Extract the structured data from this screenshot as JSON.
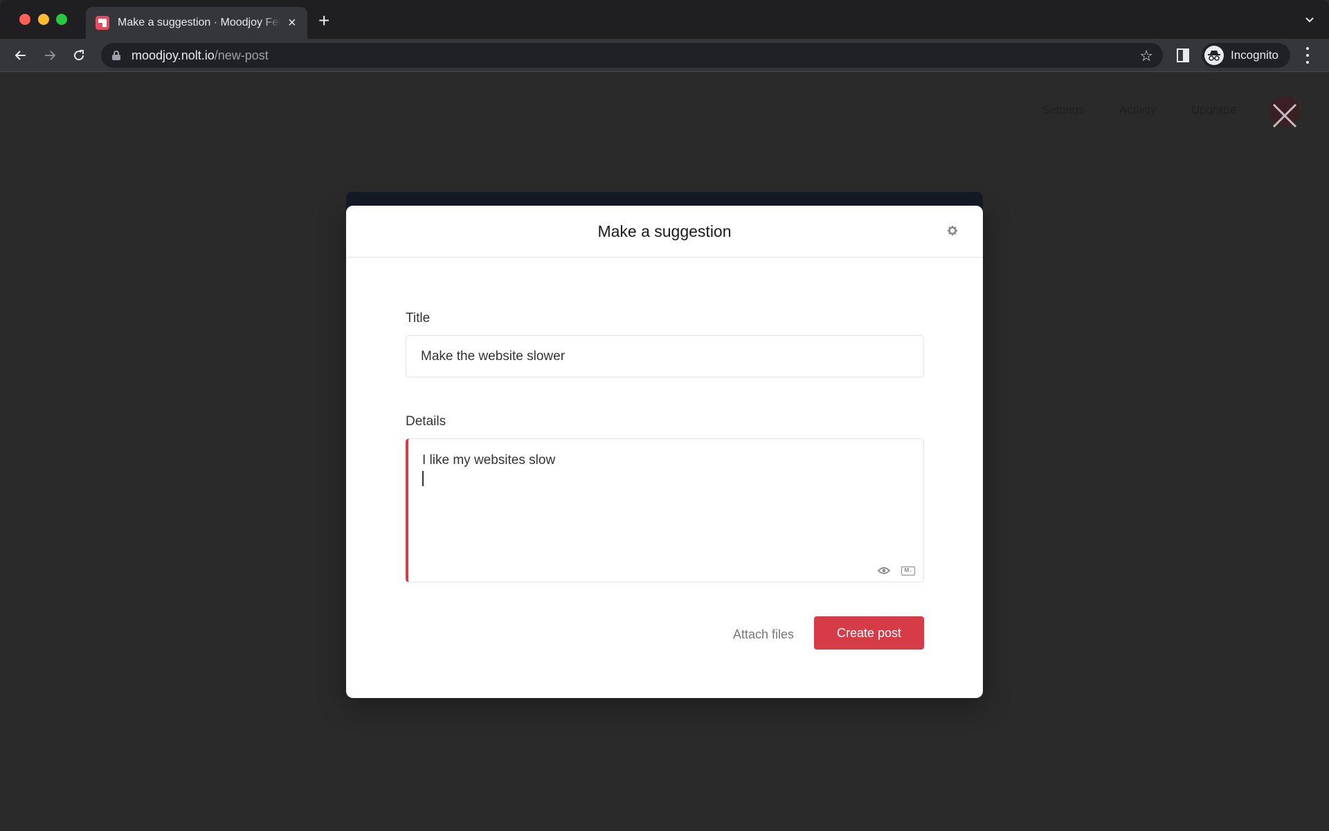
{
  "browser": {
    "tab": {
      "title": "Make a suggestion · Moodjoy Feedback",
      "close_icon": "×"
    },
    "new_tab_icon": "+",
    "url": {
      "host": "moodjoy.nolt.io",
      "path": "/new-post"
    },
    "profile_label": "Incognito"
  },
  "page_nav": {
    "items": [
      {
        "label": "Settings"
      },
      {
        "label": "Activity"
      },
      {
        "label": "Upgrade"
      }
    ]
  },
  "modal": {
    "title": "Make a suggestion",
    "title_field": {
      "label": "Title",
      "value": "Make the website slower"
    },
    "details_field": {
      "label": "Details",
      "value": "I like my websites slow",
      "markdown_badge": "M↓"
    },
    "attach_label": "Attach files",
    "submit_label": "Create post"
  },
  "colors": {
    "accent": "#d63c48",
    "overlay": "#2a2a2a"
  }
}
